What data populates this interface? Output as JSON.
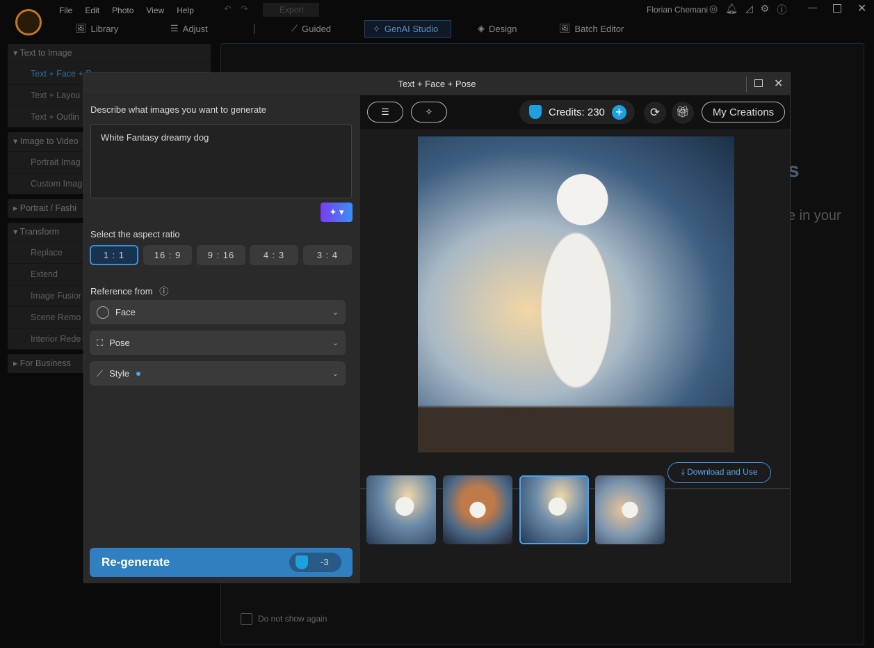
{
  "menubar": {
    "items": [
      "File",
      "Edit",
      "Photo",
      "View",
      "Help"
    ],
    "export": "Export",
    "user": "Florian Chemani"
  },
  "nav": {
    "tabs": [
      "Library",
      "Adjust",
      "Guided",
      "GenAI Studio",
      "Design",
      "Batch Editor"
    ],
    "active": "GenAI Studio"
  },
  "sidebar": [
    {
      "label": "Text to Image",
      "expanded": true,
      "items": [
        "Text + Face + P",
        "Text + Layou",
        "Text + Outlin"
      ]
    },
    {
      "label": "Image to Video",
      "expanded": true,
      "items": [
        "Portrait Imag",
        "Custom Imag"
      ]
    },
    {
      "label": "Portrait / Fashi",
      "expanded": false,
      "items": []
    },
    {
      "label": "Transform",
      "expanded": true,
      "items": [
        "Replace",
        "Extend",
        "Image Fusior",
        "Scene Remo",
        "Interior Rede"
      ]
    },
    {
      "label": "For Business",
      "expanded": false,
      "items": []
    }
  ],
  "background_page": {
    "heading_fragment": "s",
    "text_fragment": "e in your",
    "do_not_show": "Do not show again"
  },
  "dialog": {
    "title": "Text + Face + Pose",
    "prompt_label": "Describe what images you want to generate",
    "prompt_value": "White Fantasy dreamy dog",
    "aspect_label": "Select the aspect ratio",
    "ratios": [
      "1 : 1",
      "16 : 9",
      "9 : 16",
      "4 : 3",
      "3 : 4"
    ],
    "selected_ratio": "1 : 1",
    "reference_label": "Reference from",
    "references": [
      "Face",
      "Pose",
      "Style"
    ],
    "regenerate": "Re-generate",
    "cost": "-3",
    "credits": "Credits: 230",
    "my_creations": "My Creations",
    "download": "Download and Use",
    "selected_thumbnail": 3
  },
  "colors": {
    "accent": "#2f7fc1",
    "selected_border": "#4aa3f0",
    "bg": "#0a0a0a"
  }
}
